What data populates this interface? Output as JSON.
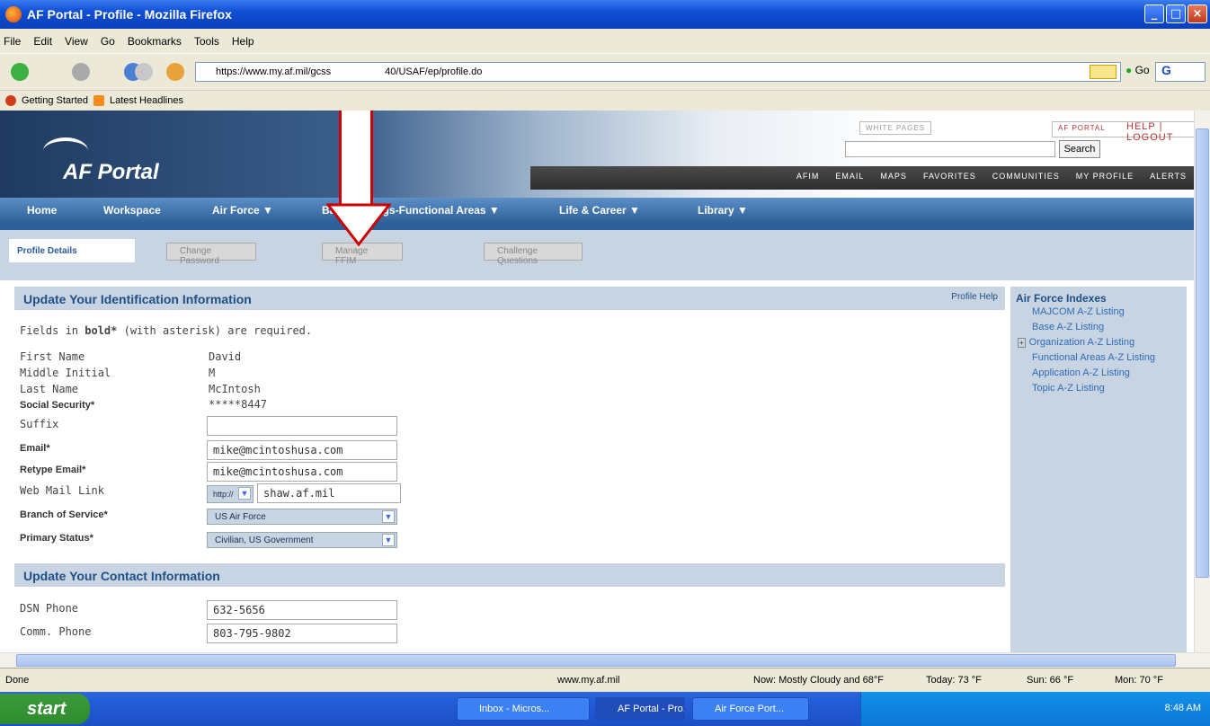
{
  "window": {
    "title": "AF Portal - Profile - Mozilla Firefox"
  },
  "menu": [
    "File",
    "Edit",
    "View",
    "Go",
    "Bookmarks",
    "Tools",
    "Help"
  ],
  "url": "https://www.my.af.mil/gcss-af/USAF/ep/profile.do",
  "url_visible_left": "https://www.my.af.mil/gcss",
  "url_visible_right": "40/USAF/ep/profile.do",
  "go_label": "Go",
  "bookmarks": {
    "getting_started": "Getting Started",
    "latest_headlines": "Latest Headlines"
  },
  "portal": {
    "logo": "AF Portal",
    "search_tabs": [
      "AF PORTAL",
      "WHITE PAGES"
    ],
    "search_button": "Search",
    "help": "HELP",
    "logout": "LOGOUT",
    "toplinks": [
      "AFIM",
      "EMAIL",
      "MAPS",
      "FAVORITES",
      "COMMUNITIES",
      "MY PROFILE",
      "ALERTS"
    ],
    "nav": [
      "Home",
      "Workspace",
      "Air Force ▼",
      "Bas",
      "rgs-Functional Areas ▼",
      "Life & Career ▼",
      "Library ▼"
    ]
  },
  "tabs": [
    "Profile Details",
    "Change Password",
    "Manage FFIM",
    "Challenge Questions"
  ],
  "identification": {
    "heading": "Update Your Identification Information",
    "profile_help": "Profile Help",
    "required_prefix": "Fields in ",
    "required_bold": "bold*",
    "required_suffix": " (with asterisk) are required.",
    "first_name_label": "First Name",
    "first_name": "David",
    "middle_initial_label": "Middle Initial",
    "middle_initial": "M",
    "last_name_label": "Last Name",
    "last_name": "McIntosh",
    "ssn_label": "Social Security*",
    "ssn": "*****8447",
    "suffix_label": "Suffix",
    "suffix": "",
    "email_label": "Email*",
    "email": "mike@mcintoshusa.com",
    "retype_email_label": "Retype Email*",
    "retype_email": "mike@mcintoshusa.com",
    "webmail_label": "Web Mail Link",
    "webmail_protocol": "http://",
    "webmail": "shaw.af.mil",
    "branch_label": "Branch of Service*",
    "branch": "US Air Force",
    "status_label": "Primary Status*",
    "status": "Civilian, US Government"
  },
  "contact": {
    "heading": "Update Your Contact Information",
    "dsn_label": "DSN Phone",
    "dsn": "632-5656",
    "comm_label": "Comm. Phone",
    "comm": "803-795-9802"
  },
  "indexes": {
    "heading": "Air Force Indexes",
    "items": [
      "MAJCOM A-Z Listing",
      "Base A-Z Listing",
      "Organization A-Z Listing",
      "Functional Areas A-Z Listing",
      "Application A-Z Listing",
      "Topic A-Z Listing"
    ]
  },
  "status": {
    "left": "Done",
    "domain": "www.my.af.mil",
    "weather_now": "Now: Mostly Cloudy and 68°F",
    "today": "Today: 73 °F",
    "sun": "Sun: 66 °F",
    "mon": "Mon: 70 °F"
  },
  "taskbar": {
    "start": "start",
    "tasks": [
      "Inbox - Micros...",
      "AF Portal - Pro...",
      "Air Force Port..."
    ],
    "clock": "8:48 AM"
  }
}
